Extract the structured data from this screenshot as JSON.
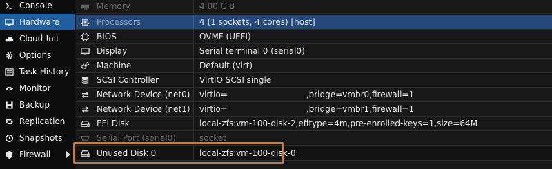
{
  "sidebar": {
    "items": [
      {
        "label": "Console",
        "icon": "terminal-icon"
      },
      {
        "label": "Hardware",
        "icon": "monitor-icon",
        "active": true
      },
      {
        "label": "Cloud-Init",
        "icon": "cloud-icon"
      },
      {
        "label": "Options",
        "icon": "gear-icon"
      },
      {
        "label": "Task History",
        "icon": "list-icon"
      },
      {
        "label": "Monitor",
        "icon": "eye-icon"
      },
      {
        "label": "Backup",
        "icon": "floppy-icon"
      },
      {
        "label": "Replication",
        "icon": "retweet-icon"
      },
      {
        "label": "Snapshots",
        "icon": "history-icon"
      },
      {
        "label": "Firewall",
        "icon": "shield-icon",
        "has_submenu": true
      }
    ]
  },
  "hardware": {
    "rows": [
      {
        "name": "Memory",
        "value": "4.00 GiB",
        "icon": "memory-icon",
        "state": "faded"
      },
      {
        "name": "Processors",
        "value": "4 (1 sockets, 4 cores) [host]",
        "icon": "cpu-icon",
        "state": "selected"
      },
      {
        "name": "BIOS",
        "value": "OVMF (UEFI)",
        "icon": "chip-icon"
      },
      {
        "name": "Display",
        "value": "Serial terminal 0 (serial0)",
        "icon": "desktop-icon"
      },
      {
        "name": "Machine",
        "value": "Default (virt)",
        "icon": "cogs-icon"
      },
      {
        "name": "SCSI Controller",
        "value": "VirtIO SCSI single",
        "icon": "database-icon"
      },
      {
        "name": "Network Device (net0)",
        "value": "virtio=",
        "value_suffix": ",bridge=vmbr0,firewall=1",
        "icon": "exchange-icon"
      },
      {
        "name": "Network Device (net1)",
        "value": "virtio=",
        "value_suffix": ",bridge=vmbr1,firewall=1",
        "icon": "exchange-icon"
      },
      {
        "name": "EFI Disk",
        "value": "local-zfs:vm-100-disk-2,efitype=4m,pre-enrolled-keys=1,size=64M",
        "icon": "hdd-icon"
      },
      {
        "name": "Serial Port (serial0)",
        "value": "socket",
        "icon": "serial-icon",
        "state": "faded"
      },
      {
        "name": "Unused Disk 0",
        "value": "local-zfs:vm-100-disk-0",
        "icon": "hdd-icon",
        "state": "hl"
      }
    ]
  },
  "colors": {
    "active_nav": "#1f5f9e",
    "selected_row": "#24487a",
    "highlight_border": "#b87f4f"
  }
}
